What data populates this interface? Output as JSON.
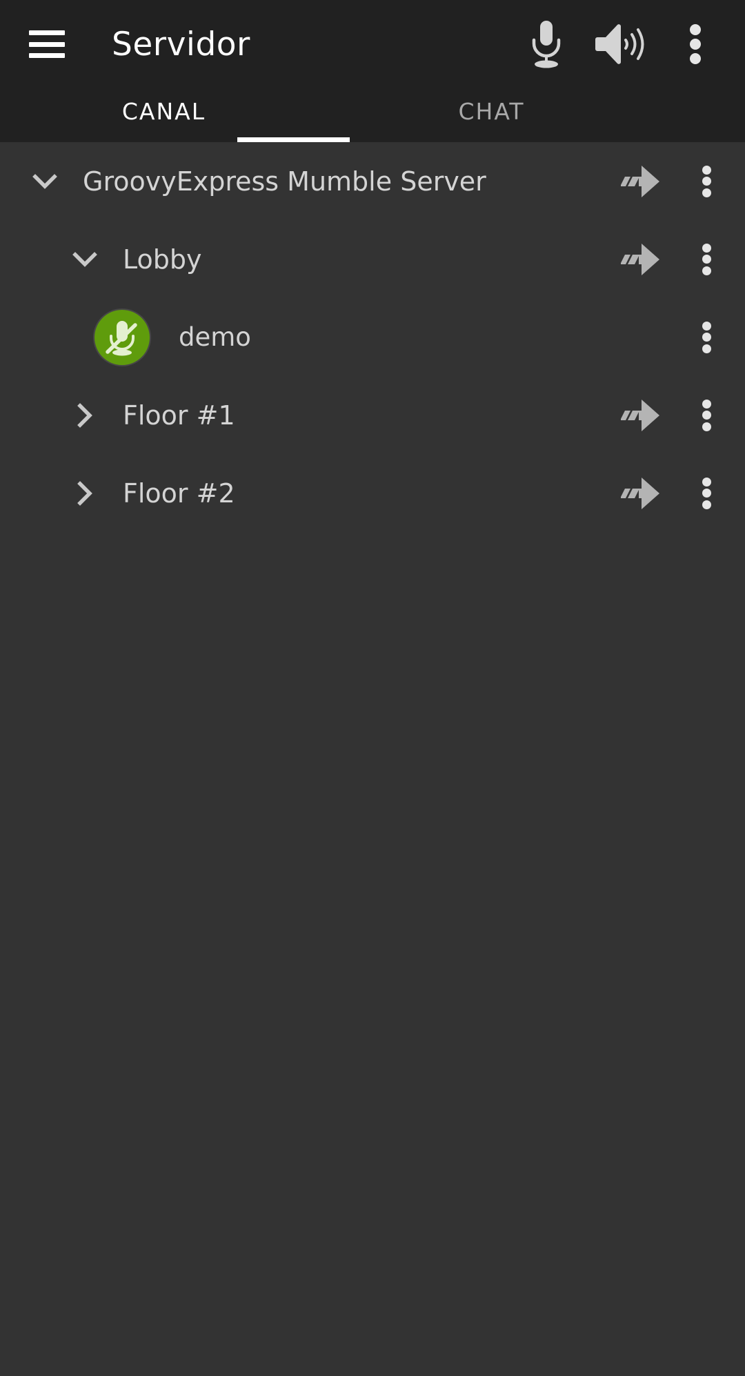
{
  "appbar": {
    "menu_icon": "hamburger-menu-icon",
    "title": "Servidor",
    "actions": [
      {
        "name": "microphone-icon",
        "label": "Microphone"
      },
      {
        "name": "speaker-icon",
        "label": "Speaker"
      },
      {
        "name": "overflow-menu-icon",
        "label": "More options"
      }
    ]
  },
  "tabs": {
    "items": [
      {
        "label": "CANAL",
        "active": true
      },
      {
        "label": "CHAT",
        "active": false
      }
    ]
  },
  "channel_tree": {
    "rows": [
      {
        "type": "channel",
        "label": "GroovyExpress Mumble Server",
        "indent": 0,
        "expander": "chevron-down-icon",
        "expanded": true,
        "has_join": true,
        "has_more": true
      },
      {
        "type": "channel",
        "label": "Lobby",
        "indent": 1,
        "expander": "chevron-down-icon",
        "expanded": true,
        "has_join": true,
        "has_more": true
      },
      {
        "type": "user",
        "label": "demo",
        "indent": 2,
        "avatar_icon": "microphone-muted-icon",
        "avatar_color": "#5f9c0c",
        "muted": true,
        "has_join": false,
        "has_more": true
      },
      {
        "type": "channel",
        "label": "Floor #1",
        "indent": 1,
        "expander": "chevron-right-icon",
        "expanded": false,
        "has_join": true,
        "has_more": true
      },
      {
        "type": "channel",
        "label": "Floor #2",
        "indent": 1,
        "expander": "chevron-right-icon",
        "expanded": false,
        "has_join": true,
        "has_more": true
      }
    ]
  },
  "colors": {
    "appbar_bg": "#212121",
    "content_bg": "#333333",
    "accent_indicator": "#ffffff",
    "text_primary": "#ffffff",
    "text_secondary": "#d4d4d4",
    "tab_inactive": "#a8a8a8",
    "avatar_green": "#5f9c0c",
    "icon_grey": "#b4b4b4"
  }
}
